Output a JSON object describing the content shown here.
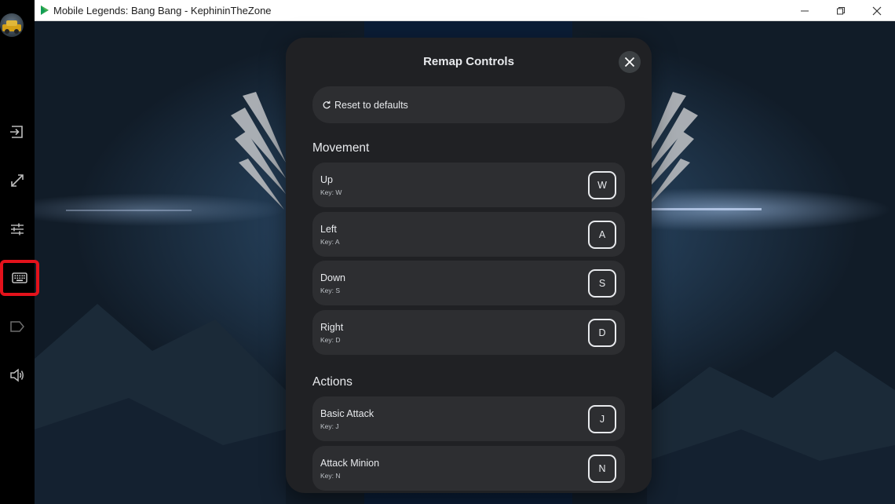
{
  "window": {
    "title": "Mobile Legends: Bang Bang - KephininTheZone"
  },
  "sidebar": {
    "items": [
      {
        "name": "exit-icon"
      },
      {
        "name": "expand-icon"
      },
      {
        "name": "sliders-icon"
      },
      {
        "name": "keyboard-icon",
        "active": true
      },
      {
        "name": "label-icon"
      },
      {
        "name": "volume-icon"
      }
    ]
  },
  "modal": {
    "title": "Remap Controls",
    "reset_label": "Reset to defaults",
    "sections": [
      {
        "title": "Movement",
        "rows": [
          {
            "label": "Up",
            "sub": "Key: W",
            "key": "W"
          },
          {
            "label": "Left",
            "sub": "Key: A",
            "key": "A"
          },
          {
            "label": "Down",
            "sub": "Key: S",
            "key": "S"
          },
          {
            "label": "Right",
            "sub": "Key: D",
            "key": "D"
          }
        ]
      },
      {
        "title": "Actions",
        "rows": [
          {
            "label": "Basic Attack",
            "sub": "Key: J",
            "key": "J"
          },
          {
            "label": "Attack Minion",
            "sub": "Key: N",
            "key": "N"
          }
        ]
      }
    ]
  },
  "colors": {
    "active_highlight": "#e3121b",
    "modal_bg": "#202124",
    "row_bg": "#2d2e31"
  }
}
